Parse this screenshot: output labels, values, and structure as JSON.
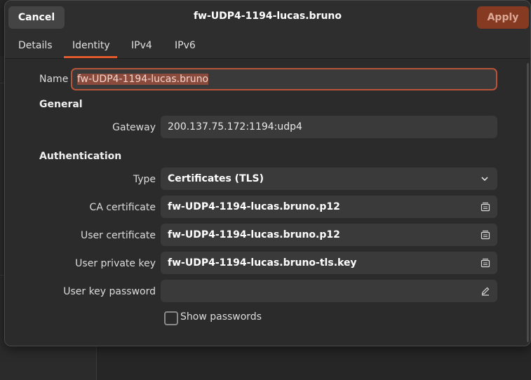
{
  "header": {
    "cancel_label": "Cancel",
    "title": "fw-UDP4-1194-lucas.bruno",
    "apply_label": "Apply"
  },
  "tabs": [
    {
      "label": "Details"
    },
    {
      "label": "Identity",
      "active": true
    },
    {
      "label": "IPv4"
    },
    {
      "label": "IPv6"
    }
  ],
  "form": {
    "name_label": "Name",
    "name_value": "fw-UDP4-1194-lucas.bruno",
    "general_heading": "General",
    "gateway_label": "Gateway",
    "gateway_value": "200.137.75.172:1194:udp4",
    "auth_heading": "Authentication",
    "type_label": "Type",
    "type_value": "Certificates (TLS)",
    "ca_label": "CA certificate",
    "ca_value": "fw-UDP4-1194-lucas.bruno.p12",
    "user_cert_label": "User certificate",
    "user_cert_value": "fw-UDP4-1194-lucas.bruno.p12",
    "private_key_label": "User private key",
    "private_key_value": "fw-UDP4-1194-lucas.bruno-tls.key",
    "key_password_label": "User key password",
    "key_password_value": "",
    "show_passwords_label": "Show passwords",
    "show_passwords_checked": false
  },
  "icons": {
    "file_chooser": "file-chooser-icon",
    "password_edit": "edit-pencil-icon",
    "dropdown": "chevron-down-icon"
  },
  "colors": {
    "accent": "#e25a2c",
    "apply_button": "#873a22",
    "dialog_bg": "#2e2e2e",
    "field_bg": "#3a3a3a"
  }
}
